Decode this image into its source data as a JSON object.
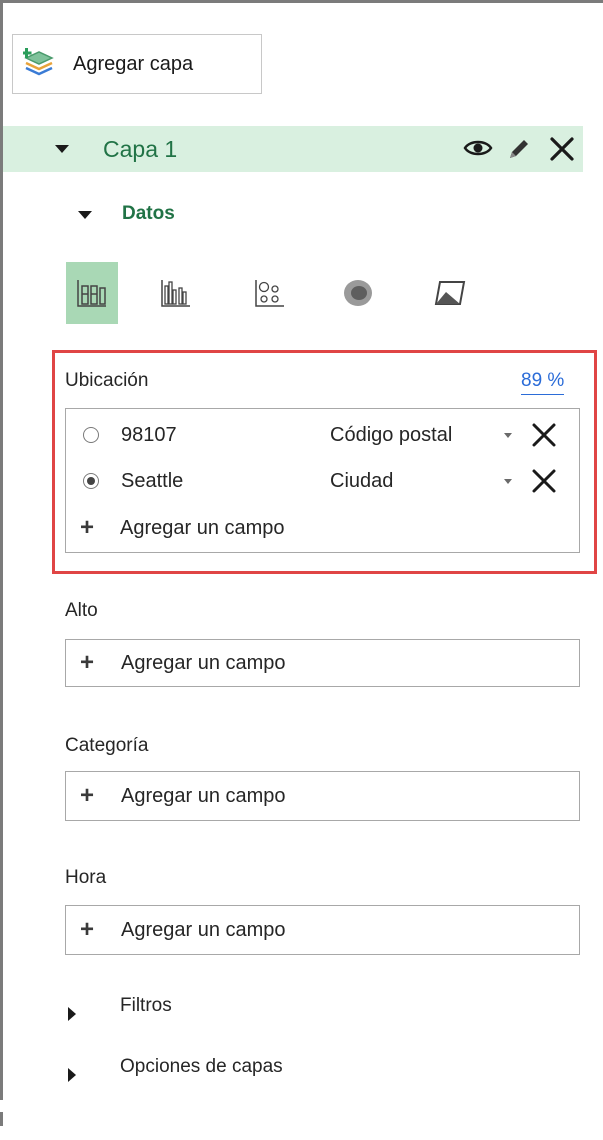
{
  "toolbar": {
    "add_layer_label": "Agregar capa"
  },
  "layer": {
    "name": "Capa 1"
  },
  "data_section": {
    "label": "Datos"
  },
  "viz_types": [
    "stacked-column",
    "clustered-column",
    "bubble",
    "heat-map",
    "region"
  ],
  "location": {
    "label": "Ubicación",
    "confidence": "89 %",
    "fields": [
      {
        "name": "98107",
        "type": "Código postal",
        "selected": false
      },
      {
        "name": "Seattle",
        "type": "Ciudad",
        "selected": true
      }
    ],
    "add_field": "Agregar un campo"
  },
  "height": {
    "label": "Alto",
    "add_field": "Agregar un campo"
  },
  "category": {
    "label": "Categoría",
    "add_field": "Agregar un campo"
  },
  "time": {
    "label": "Hora",
    "add_field": "Agregar un campo"
  },
  "filters": {
    "label": "Filtros"
  },
  "layer_options": {
    "label": "Opciones de capas"
  },
  "colors": {
    "accent_green": "#217346",
    "header_bg": "#d9f0e0",
    "active_viz": "#a9d8b5",
    "highlight_border": "#e04545",
    "link_blue": "#2b6cd8"
  }
}
